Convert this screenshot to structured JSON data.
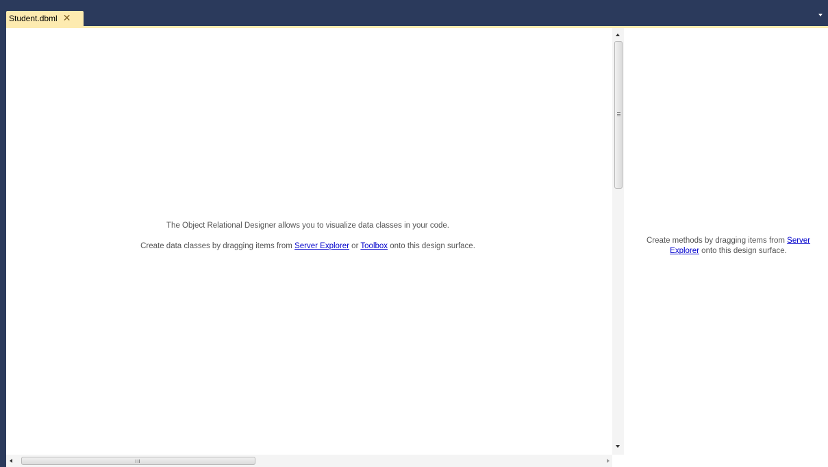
{
  "tab": {
    "title": "Student.dbml",
    "close_glyph": "✕"
  },
  "colors": {
    "frame": "#2b3a5c",
    "tab_active": "#fdebb0",
    "link": "#0000cc",
    "hint_text": "#555555"
  },
  "designer": {
    "intro": "The Object Relational Designer allows you to visualize data classes in your code.",
    "create_prefix": "Create data classes by dragging items from ",
    "server_explorer_link": "Server Explorer",
    "or_text": " or ",
    "toolbox_link": "Toolbox",
    "create_suffix": " onto this design surface."
  },
  "methods_pane": {
    "prefix": "Create methods by dragging items from ",
    "server_explorer_link": "Server Explorer",
    "suffix": " onto this design surface."
  },
  "icons": {
    "tab_close": "close-icon",
    "dropdown": "chevron-down-icon",
    "scroll_up": "arrow-up-icon",
    "scroll_down": "arrow-down-icon",
    "scroll_left": "arrow-left-icon",
    "scroll_right": "arrow-right-icon"
  }
}
